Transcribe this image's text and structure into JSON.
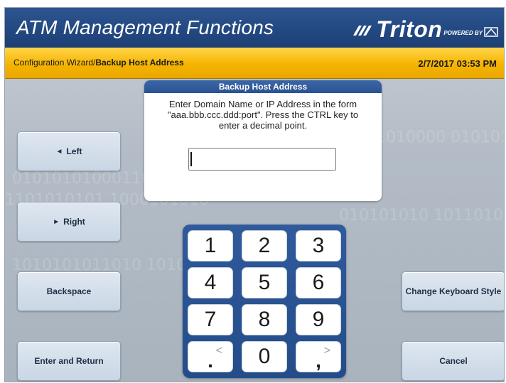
{
  "header": {
    "title": "ATM Management Functions",
    "brand_name": "Triton",
    "brand_sub": "POWERED BY"
  },
  "status": {
    "breadcrumb_parent": "Configuration Wizard/",
    "breadcrumb_current": "Backup Host Address",
    "datetime": "2/7/2017  03:53 PM"
  },
  "side_buttons": {
    "left": "Left",
    "right": "Right",
    "backspace": "Backspace",
    "enter_return": "Enter and Return",
    "change_keyboard": "Change Keyboard Style",
    "cancel": "Cancel"
  },
  "dialog": {
    "title": "Backup Host Address",
    "message": "Enter Domain Name or IP Address in the form \"aaa.bbb.ccc.ddd:port\". Press the CTRL key to enter a decimal point.",
    "input_value": ""
  },
  "keypad": {
    "k1": "1",
    "k2": "2",
    "k3": "3",
    "k4": "4",
    "k5": "5",
    "k6": "6",
    "k7": "7",
    "k8": "8",
    "k9": "9",
    "k_dot": ".",
    "k_dot_alt": "<",
    "k0": "0",
    "k_comma": ",",
    "k_comma_alt": ">"
  },
  "background_digits": [
    "0101010100011010",
    "1101010101  1000101010",
    "0101010000  01010101",
    "1010101011010  10101",
    "010101010  1011010"
  ],
  "colors": {
    "title_bar": "#244a83",
    "status_bar": "#f6b400",
    "dialog_header": "#2a5291",
    "keypad": "#2f5a9c"
  }
}
